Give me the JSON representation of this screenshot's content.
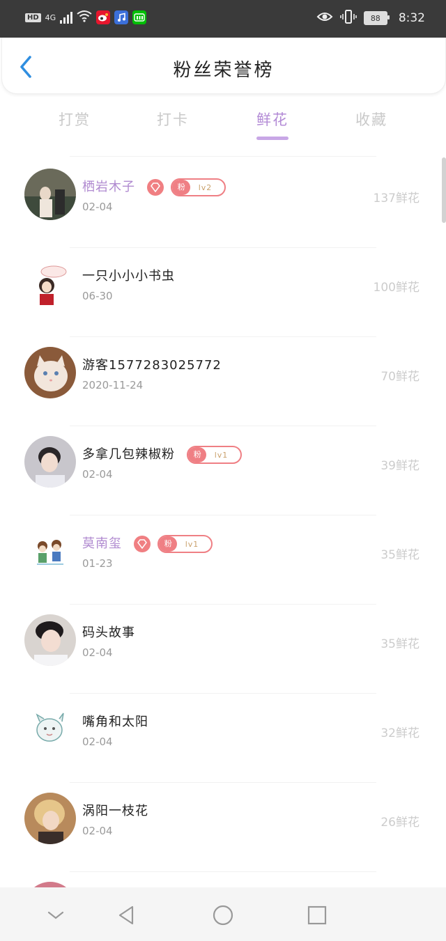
{
  "status_bar": {
    "hd": "HD",
    "network": "4G",
    "battery": "88",
    "time": "8:32",
    "colors": {
      "weibo": "#e6162d",
      "music": "#3b6fd9",
      "iqiyi": "#00be06"
    }
  },
  "header": {
    "title": "粉丝荣誉榜",
    "back_icon": "chevron-left-icon"
  },
  "tabs": [
    {
      "label": "打赏",
      "active": false
    },
    {
      "label": "打卡",
      "active": false
    },
    {
      "label": "鲜花",
      "active": true
    },
    {
      "label": "收藏",
      "active": false
    }
  ],
  "rows": [
    {
      "name": "栖岩木子",
      "date": "02-04",
      "amount": "137鲜花",
      "vip": true,
      "fan_label": "粉",
      "level": "lv2"
    },
    {
      "name": "一只小小小书虫",
      "date": "06-30",
      "amount": "100鲜花",
      "vip": false
    },
    {
      "name": "游客1577283025772",
      "date": "2020-11-24",
      "amount": "70鲜花",
      "vip": false
    },
    {
      "name": "多拿几包辣椒粉",
      "date": "02-04",
      "amount": "39鲜花",
      "vip": false,
      "fan_label": "粉",
      "level": "lv1"
    },
    {
      "name": "莫南玺",
      "date": "01-23",
      "amount": "35鲜花",
      "vip": true,
      "fan_label": "粉",
      "level": "lv1"
    },
    {
      "name": "码头故事",
      "date": "02-04",
      "amount": "35鲜花",
      "vip": false
    },
    {
      "name": "嘴角和太阳",
      "date": "02-04",
      "amount": "32鲜花",
      "vip": false
    },
    {
      "name": "涡阳一枝花",
      "date": "02-04",
      "amount": "26鲜花",
      "vip": false
    }
  ],
  "colors": {
    "accent": "#b38bd6",
    "badge": "#ef7f84",
    "back": "#2f8ee0"
  }
}
